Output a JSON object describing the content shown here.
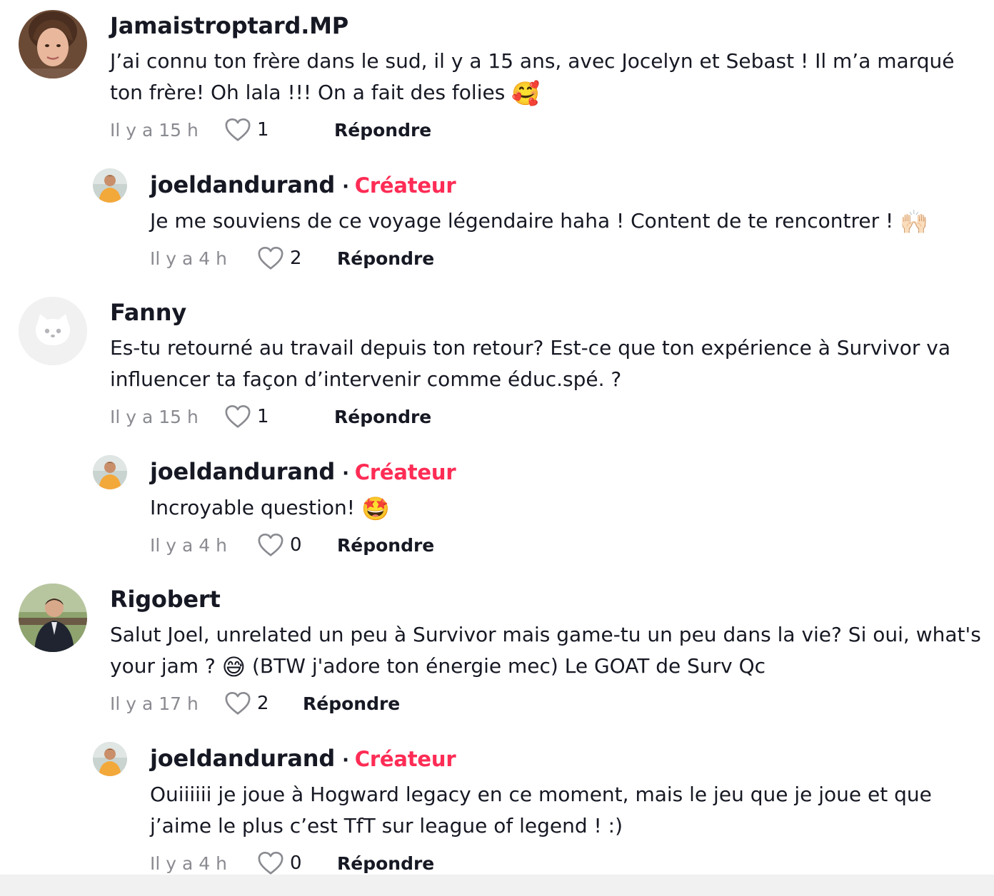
{
  "colors": {
    "creator_accent": "#fe2c55",
    "meta_gray": "#8a8b91",
    "text_primary": "#161823"
  },
  "comments": [
    {
      "username": "Jamaistroptard.MP",
      "text": "J’ai connu ton frère dans le sud, il y a 15 ans, avec Jocelyn et Sebast ! Il m’a marqué ton frère! Oh lala !!! On a fait des folies ",
      "emoji": "🥰",
      "time": "Il y a 15 h",
      "likes": "1",
      "reply_label": "Répondre",
      "avatar": "photo-woman-avatar",
      "reply": {
        "username": "joeldandurand",
        "badge": "Créateur",
        "text": "Je me souviens de ce voyage légendaire haha ! Content de te rencontrer ! ",
        "emoji": "🙌🏻",
        "time": "Il y a 4 h",
        "likes": "2",
        "reply_label": "Répondre",
        "avatar": "creator-avatar"
      }
    },
    {
      "username": "Fanny",
      "text": "Es-tu retourné au travail depuis ton retour? Est-ce que ton expérience à Survivor va influencer ta façon d’intervenir comme éduc.spé. ?",
      "emoji": "",
      "time": "Il y a 15 h",
      "likes": "1",
      "reply_label": "Répondre",
      "avatar": "default-avatar-icon",
      "reply": {
        "username": "joeldandurand",
        "badge": "Créateur",
        "text": "Incroyable question! ",
        "emoji": "🤩",
        "time": "Il y a 4 h",
        "likes": "0",
        "reply_label": "Répondre",
        "avatar": "creator-avatar"
      }
    },
    {
      "username": "Rigobert",
      "text_before": "Salut Joel, unrelated un peu à Survivor mais game-tu un peu dans la vie? Si oui, what's your jam ? ",
      "emoji": "😅",
      "text_after": " (BTW j'adore ton énergie mec) Le GOAT de Surv Qc",
      "time": "Il y a 17 h",
      "likes": "2",
      "reply_label": "Répondre",
      "avatar": "photo-man-avatar",
      "reply": {
        "username": "joeldandurand",
        "badge": "Créateur",
        "text": "Ouiiiiii je joue à Hogward legacy en ce moment, mais le jeu que je joue et que j’aime le plus c’est TfT sur league of legend ! :)",
        "time": "Il y a 4 h",
        "likes": "0",
        "reply_label": "Répondre",
        "avatar": "creator-avatar"
      }
    }
  ]
}
